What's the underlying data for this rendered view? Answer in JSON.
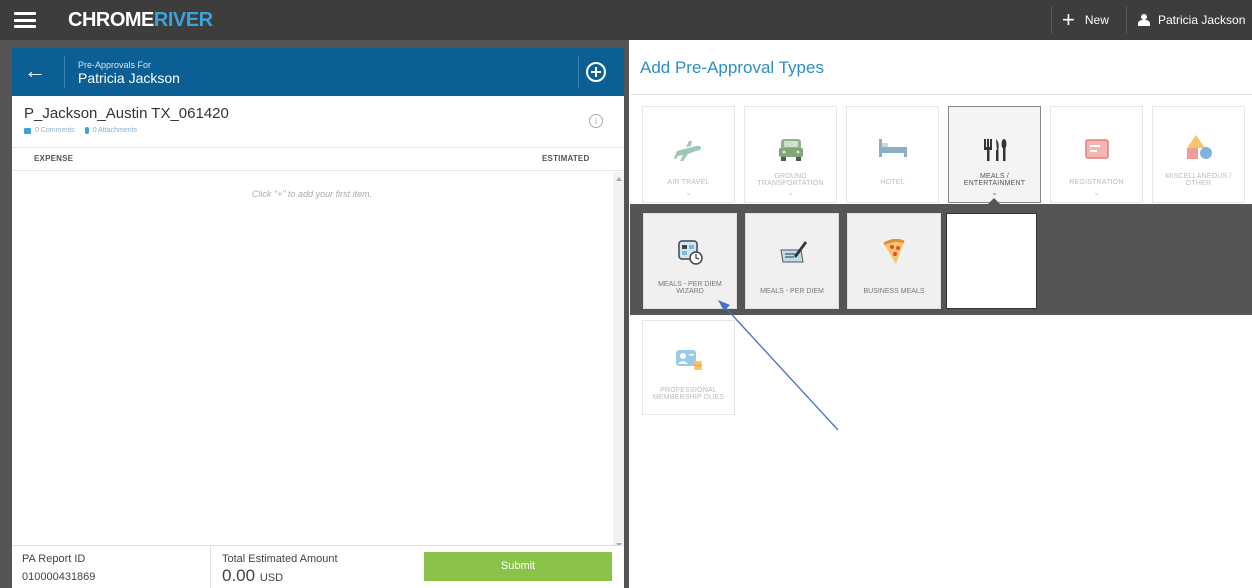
{
  "topbar": {
    "brand_part1": "CHROME",
    "brand_part2": "RIVER",
    "new_label": "New",
    "user_name": "Patricia Jackson"
  },
  "left_panel": {
    "subtitle": "Pre-Approvals For",
    "title": "Patricia Jackson",
    "report_name": "P_Jackson_Austin TX_061420",
    "comments": "0 Comments",
    "attachments": "0 Attachments",
    "col_expense": "EXPENSE",
    "col_estimated": "ESTIMATED",
    "empty_message": "Click \"+\" to add your first item.",
    "footer": {
      "report_id_label": "PA Report ID",
      "report_id": "010000431869",
      "total_label": "Total Estimated Amount",
      "total_amount": "0.00",
      "currency": "USD",
      "submit_label": "Submit"
    }
  },
  "right_panel": {
    "title": "Add Pre-Approval Types",
    "categories": [
      {
        "line1": "",
        "line2": "AIR TRAVEL"
      },
      {
        "line1": "GROUND",
        "line2": "TRANSPORTATION"
      },
      {
        "line1": "",
        "line2": "HOTEL"
      },
      {
        "line1": "MEALS /",
        "line2": "ENTERTAINMENT"
      },
      {
        "line1": "",
        "line2": "REGISTRATION"
      },
      {
        "line1": "MISCELLANEOUS /",
        "line2": "OTHER"
      }
    ],
    "meals_subtypes": [
      {
        "line1": "MEALS - PER DIEM",
        "line2": "WIZARD"
      },
      {
        "line1": "",
        "line2": "MEALS - PER DIEM"
      },
      {
        "line1": "",
        "line2": "BUSINESS MEALS"
      }
    ],
    "extra_types": [
      {
        "line1": "PROFESSIONAL",
        "line2": "MEMBERSHIP DUES"
      }
    ]
  },
  "colors": {
    "topbar": "#3d3d3d",
    "header_blue": "#0c5f94",
    "title_blue": "#2a8fc7",
    "submit_green": "#8bc34a",
    "frame_gray": "#555555"
  }
}
